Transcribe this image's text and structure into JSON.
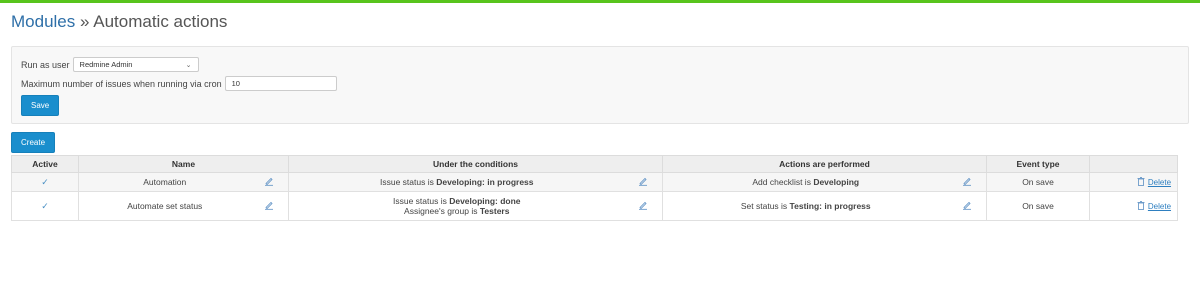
{
  "breadcrumb": {
    "parent": "Modules",
    "separator": " » ",
    "current": "Automatic actions"
  },
  "settings": {
    "run_as_label": "Run as user",
    "run_as_value": "Redmine Admin",
    "max_label": "Maximum number of issues when running via cron",
    "max_value": "10",
    "save_label": "Save"
  },
  "create_label": "Create",
  "table": {
    "headers": {
      "active": "Active",
      "name": "Name",
      "conditions": "Under the conditions",
      "actions": "Actions are performed",
      "event": "Event type"
    },
    "rows": [
      {
        "name": "Automation",
        "cond1_prefix": "Issue status is ",
        "cond1_value": "Developing: in progress",
        "action_prefix": "Add checklist is ",
        "action_value": "Developing",
        "event": "On save",
        "delete": "Delete"
      },
      {
        "name": "Automate set status",
        "cond1_prefix": "Issue status is ",
        "cond1_value": "Developing: done",
        "cond2_prefix": "Assignee's group is ",
        "cond2_value": "Testers",
        "action_prefix": "Set status is ",
        "action_value": "Testing: in progress",
        "event": "On save",
        "delete": "Delete"
      }
    ]
  },
  "colors": {
    "accent": "#58c41c",
    "button": "#1a8ecd",
    "link": "#2e6fa8"
  },
  "icons": {
    "active": "check-icon",
    "edit": "pencil-icon",
    "delete": "trash-icon",
    "select": "chevron-down-icon"
  }
}
